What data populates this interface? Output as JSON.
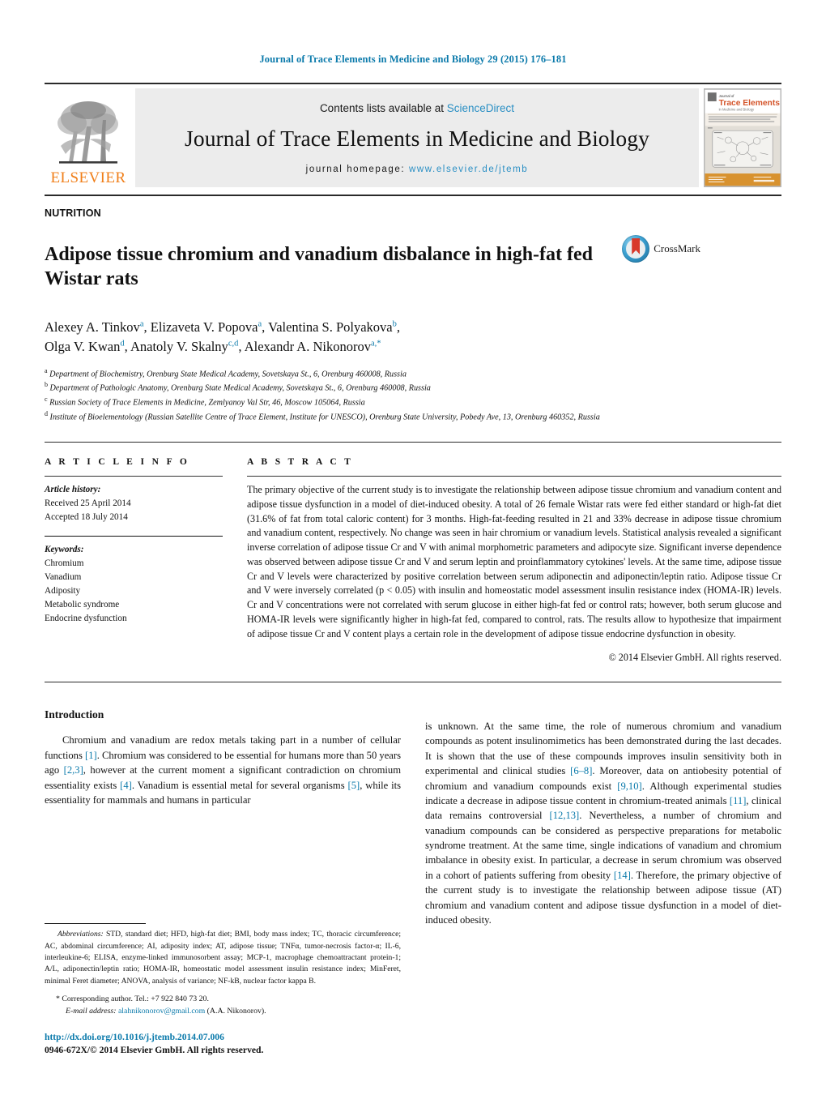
{
  "running_head": "Journal of Trace Elements in Medicine and Biology 29 (2015) 176–181",
  "masthead": {
    "contents_prefix": "Contents lists available at ",
    "sciencedirect": "ScienceDirect",
    "journal_title": "Journal of Trace Elements in Medicine and Biology",
    "homepage_prefix": "journal homepage: ",
    "homepage_url": "www.elsevier.de/jtemb",
    "publisher": "ELSEVIER",
    "cover": {
      "journal_word": "Journal of",
      "title_line": "Trace Elements",
      "subtitle_line": "in Medicine and Biology",
      "volume_line": "Volume 29"
    },
    "colors": {
      "link": "#2a8fc4",
      "elsevier_orange": "#f07f1a",
      "band_bg": "#ececec"
    }
  },
  "article": {
    "section_label": "NUTRITION",
    "title": "Adipose tissue chromium and vanadium disbalance in high-fat fed Wistar rats",
    "crossmark_label": "CrossMark",
    "authors_line_1": "Alexey A. Tinkov",
    "authors": [
      {
        "name": "Alexey A. Tinkov",
        "sup": "a"
      },
      {
        "name": "Elizaveta V. Popova",
        "sup": "a"
      },
      {
        "name": "Valentina S. Polyakova",
        "sup": "b"
      },
      {
        "name": "Olga V. Kwan",
        "sup": "d"
      },
      {
        "name": "Anatoly V. Skalny",
        "sup": "c,d"
      },
      {
        "name": "Alexandr A. Nikonorov",
        "sup": "a,*"
      }
    ],
    "affiliations": [
      {
        "mark": "a",
        "text": "Department of Biochemistry, Orenburg State Medical Academy, Sovetskaya St., 6, Orenburg 460008, Russia"
      },
      {
        "mark": "b",
        "text": "Department of Pathologic Anatomy, Orenburg State Medical Academy, Sovetskaya St., 6, Orenburg 460008, Russia"
      },
      {
        "mark": "c",
        "text": "Russian Society of Trace Elements in Medicine, Zemlyanoy Val Str, 46, Moscow 105064, Russia"
      },
      {
        "mark": "d",
        "text": "Institute of Bioelementology (Russian Satellite Centre of Trace Element, Institute for UNESCO), Orenburg State University, Pobedy Ave, 13, Orenburg 460352, Russia"
      }
    ]
  },
  "article_info": {
    "heading": "A R T I C L E   I N F O",
    "history_label": "Article history:",
    "received": "Received 25 April 2014",
    "accepted": "Accepted 18 July 2014",
    "keywords_label": "Keywords:",
    "keywords": [
      "Chromium",
      "Vanadium",
      "Adiposity",
      "Metabolic syndrome",
      "Endocrine dysfunction"
    ]
  },
  "abstract": {
    "heading": "A B S T R A C T",
    "text": "The primary objective of the current study is to investigate the relationship between adipose tissue chromium and vanadium content and adipose tissue dysfunction in a model of diet-induced obesity. A total of 26 female Wistar rats were fed either standard or high-fat diet (31.6% of fat from total caloric content) for 3 months. High-fat-feeding resulted in 21 and 33% decrease in adipose tissue chromium and vanadium content, respectively. No change was seen in hair chromium or vanadium levels. Statistical analysis revealed a significant inverse correlation of adipose tissue Cr and V with animal morphometric parameters and adipocyte size. Significant inverse dependence was observed between adipose tissue Cr and V and serum leptin and proinflammatory cytokines' levels. At the same time, adipose tissue Cr and V levels were characterized by positive correlation between serum adiponectin and adiponectin/leptin ratio. Adipose tissue Cr and V were inversely correlated (p < 0.05) with insulin and homeostatic model assessment insulin resistance index (HOMA-IR) levels. Cr and V concentrations were not correlated with serum glucose in either high-fat fed or control rats; however, both serum glucose and HOMA-IR levels were significantly higher in high-fat fed, compared to control, rats. The results allow to hypothesize that impairment of adipose tissue Cr and V content plays a certain role in the development of adipose tissue endocrine dysfunction in obesity.",
    "copyright": "© 2014 Elsevier GmbH. All rights reserved."
  },
  "introduction": {
    "heading": "Introduction",
    "left_para_start": "Chromium and vanadium are redox metals taking part in a number of cellular functions ",
    "left_segments": [
      {
        "t": "Chromium and vanadium are redox metals taking part in a number of cellular functions ",
        "ref": false
      },
      {
        "t": "[1]",
        "ref": true
      },
      {
        "t": ". Chromium was considered to be essential for humans more than 50 years ago ",
        "ref": false
      },
      {
        "t": "[2,3]",
        "ref": true
      },
      {
        "t": ", however at the current moment a significant contradiction on chromium essentiality exists ",
        "ref": false
      },
      {
        "t": "[4]",
        "ref": true
      },
      {
        "t": ". Vanadium is essential metal for several organisms ",
        "ref": false
      },
      {
        "t": "[5]",
        "ref": true
      },
      {
        "t": ", while its essentiality for mammals and humans in particular",
        "ref": false
      }
    ],
    "right_segments": [
      {
        "t": "is unknown. At the same time, the role of numerous chromium and vanadium compounds as potent insulinomimetics has been demonstrated during the last decades. It is shown that the use of these compounds improves insulin sensitivity both in experimental and clinical studies ",
        "ref": false
      },
      {
        "t": "[6–8]",
        "ref": true
      },
      {
        "t": ". Moreover, data on antiobesity potential of chromium and vanadium compounds exist ",
        "ref": false
      },
      {
        "t": "[9,10]",
        "ref": true
      },
      {
        "t": ". Although experimental studies indicate a decrease in adipose tissue content in chromium-treated animals ",
        "ref": false
      },
      {
        "t": "[11]",
        "ref": true
      },
      {
        "t": ", clinical data remains controversial ",
        "ref": false
      },
      {
        "t": "[12,13]",
        "ref": true
      },
      {
        "t": ". Nevertheless, a number of chromium and vanadium compounds can be considered as perspective preparations for metabolic syndrome treatment. At the same time, single indications of vanadium and chromium imbalance in obesity exist. In particular, a decrease in serum chromium was observed in a cohort of patients suffering from obesity ",
        "ref": false
      },
      {
        "t": "[14]",
        "ref": true
      },
      {
        "t": ". Therefore, the primary objective of the current study is to investigate the relationship between adipose tissue (AT) chromium and vanadium content and adipose tissue dysfunction in a model of diet-induced obesity.",
        "ref": false
      }
    ]
  },
  "footnotes": {
    "abbreviations_label": "Abbreviations:",
    "abbreviations_text": " STD, standard diet; HFD, high-fat diet; BMI, body mass index; TC, thoracic circumference; AC, abdominal circumference; AI, adiposity index; AT, adipose tissue; TNFα, tumor-necrosis factor-α; IL-6, interleukine-6; ELISA, enzyme-linked immunosorbent assay; MCP-1, macrophage chemoattractant protein-1; A/L, adiponectin/leptin ratio; HOMA-IR, homeostatic model assessment insulin resistance index; MinFeret, minimal Feret diameter; ANOVA, analysis of variance; NF-kB, nuclear factor kappa B.",
    "corresponding_star": "*",
    "corresponding_text": "Corresponding author. Tel.: +7 922 840 73 20.",
    "email_label": "E-mail address:",
    "email": "alahnikonorov@gmail.com",
    "email_owner": "(A.A. Nikonorov).",
    "doi": "http://dx.doi.org/10.1016/j.jtemb.2014.07.006",
    "issn_line": "0946-672X/© 2014 Elsevier GmbH. All rights reserved."
  }
}
